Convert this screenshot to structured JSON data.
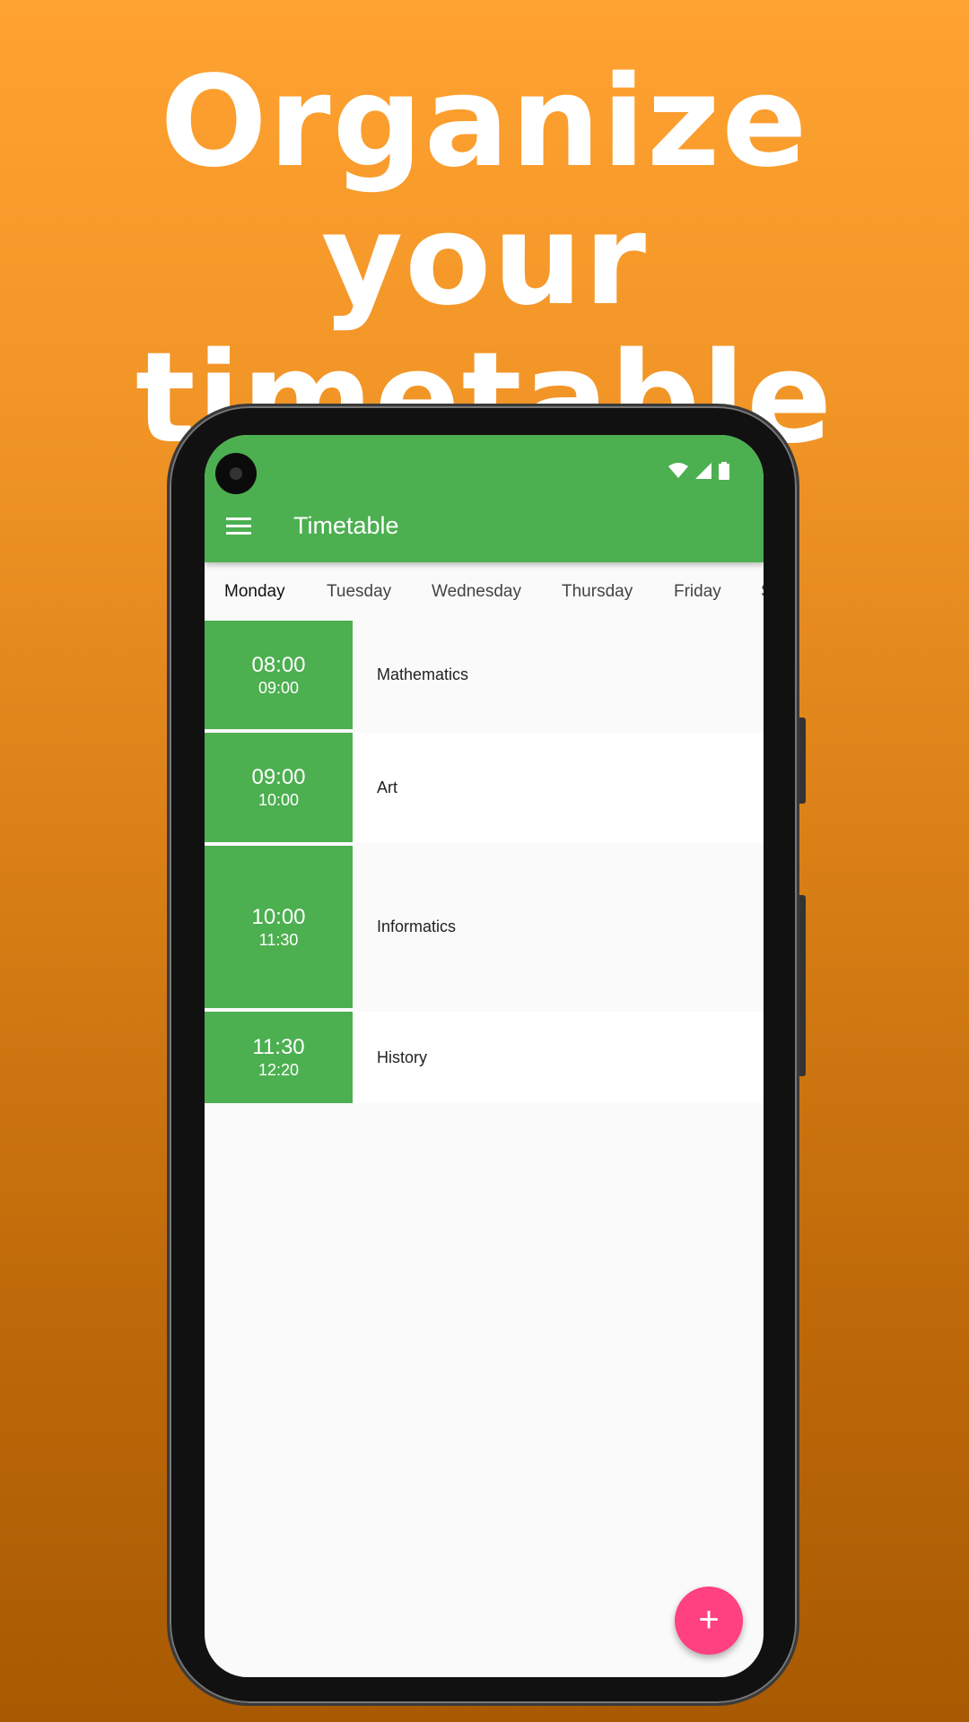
{
  "headline": {
    "line1": "Organize your",
    "line2": "timetable"
  },
  "colors": {
    "primary": "#4caf50",
    "accent": "#ff4081"
  },
  "status_bar": {
    "icons": [
      "wifi-icon",
      "cell-signal-icon",
      "battery-icon"
    ]
  },
  "appbar": {
    "menu_icon": "hamburger-menu-icon",
    "title": "Timetable"
  },
  "tabs": [
    {
      "label": "Monday",
      "active": true
    },
    {
      "label": "Tuesday"
    },
    {
      "label": "Wednesday"
    },
    {
      "label": "Thursday"
    },
    {
      "label": "Friday"
    },
    {
      "label": "S"
    }
  ],
  "lessons": [
    {
      "start": "08:00",
      "end": "09:00",
      "subject": "Mathematics"
    },
    {
      "start": "09:00",
      "end": "10:00",
      "subject": "Art"
    },
    {
      "start": "10:00",
      "end": "11:30",
      "subject": "Informatics"
    },
    {
      "start": "11:30",
      "end": "12:20",
      "subject": "History"
    }
  ],
  "fab": {
    "icon": "plus-icon",
    "label": "+"
  }
}
